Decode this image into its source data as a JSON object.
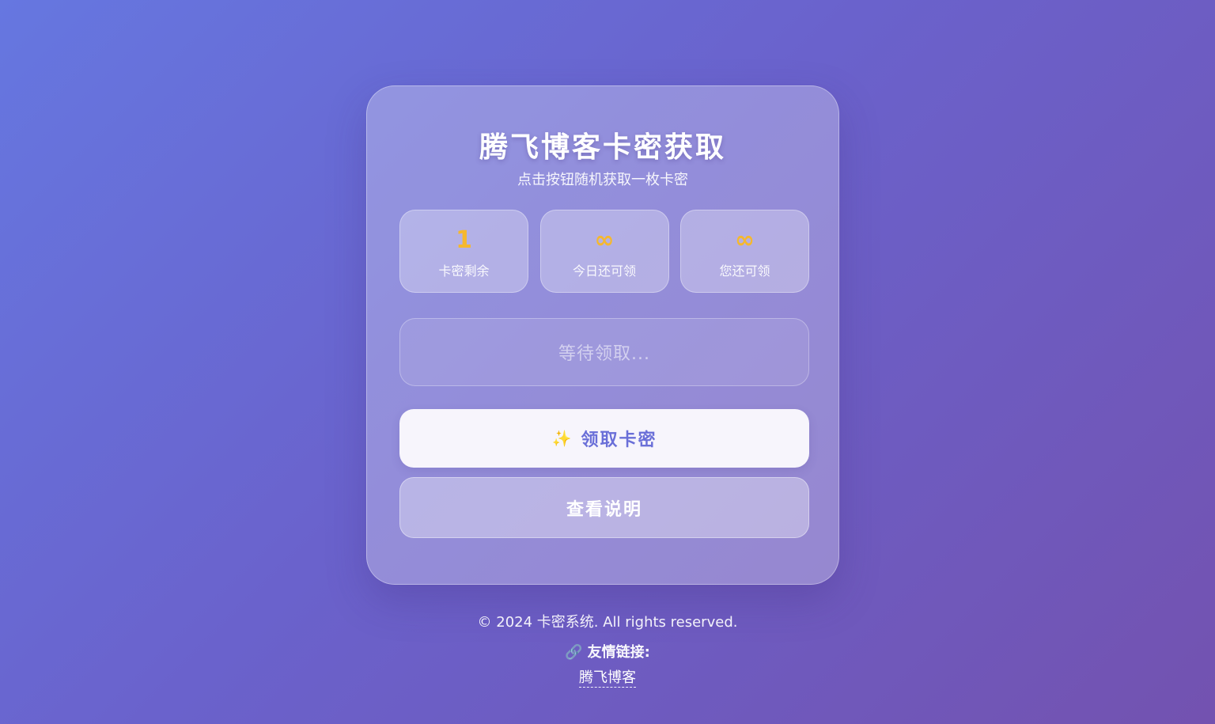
{
  "card": {
    "title": "腾飞博客卡密获取",
    "subtitle": "点击按钮随机获取一枚卡密",
    "stats": [
      {
        "value": "1",
        "label": "卡密剩余"
      },
      {
        "value": "∞",
        "label": "今日还可领"
      },
      {
        "value": "∞",
        "label": "您还可领"
      }
    ],
    "result_placeholder": "等待领取...",
    "claim_button": {
      "icon": "sparkles-icon",
      "glyph": "✨",
      "label": "领取卡密"
    },
    "help_button": {
      "label": "查看说明"
    }
  },
  "footer": {
    "copyright": "© 2024 卡密系统. All rights reserved.",
    "links_title": "友情链接:",
    "links_icon": "🔗",
    "links": [
      {
        "label": "腾飞博客"
      }
    ]
  },
  "colors": {
    "accent": "#f5b82e",
    "primary_button_text": "#6a6fd8",
    "bg_start": "#6677e0",
    "bg_end": "#7352b0"
  }
}
